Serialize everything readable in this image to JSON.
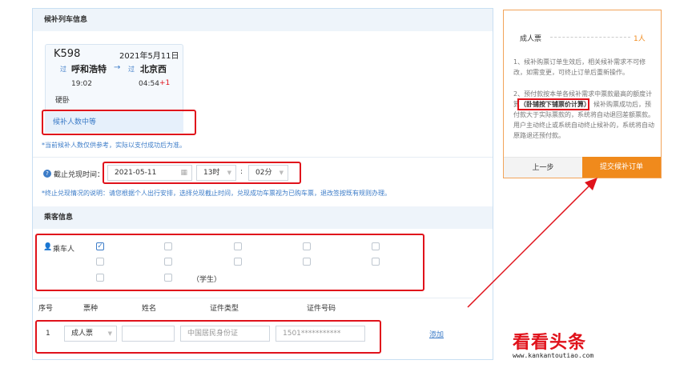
{
  "train_section": {
    "title": "候补列车信息"
  },
  "train": {
    "number": "K598",
    "date": "2021年5月11日",
    "from_tag": "过",
    "from_station": "呼和浩特",
    "to_tag": "过",
    "to_station": "北京西",
    "depart_time": "19:02",
    "arrive_time": "04:54",
    "arrive_plus": "+1",
    "seat": "硬卧",
    "waiting_status": "候补人数中等"
  },
  "note_waiting": "*当前候补人数仅供参考，实际以支付成功后为准。",
  "deadline": {
    "label": "截止兑现时间：",
    "date_value": "2021-05-11",
    "hour_value": "13时",
    "colon": ":",
    "minute_value": "02分"
  },
  "note_deadline": "*终止兑现情况的说明：请您根据个人出行安排，选择兑现截止时间，兑现成功车票视为已购车票，退改签按既有规则办理。",
  "passenger_section": {
    "title": "乘客信息"
  },
  "passengers": {
    "label": "乘车人",
    "student_tag": "（学生）"
  },
  "table": {
    "headers": [
      "序号",
      "票种",
      "姓名",
      "证件类型",
      "证件号码"
    ],
    "row": {
      "index": "1",
      "ticket_type": "成人票",
      "name": "",
      "id_type_placeholder": "中国居民身份证",
      "id_number": "1501***********"
    },
    "add_link": "添加"
  },
  "side": {
    "ticket_label": "成人票",
    "ticket_count": "1人",
    "tip1": "1、候补购票订单生效后，相关候补需求不可修改，如需变更，可终止订单后重新操作。",
    "tip2_a": "2、预付款按本单各候补需求中票款最高的额度计算",
    "tip2_highlight": "（卧铺按下铺票价计算）",
    "tip2_b": "；候补购票成功后，预付款大于实际票款的，系统将自动退回差额票款。用户主动终止或系统自动终止候补的，系统将自动原路退还预付款。",
    "prev_label": "上一步",
    "submit_label": "提交候补订单"
  },
  "watermark": {
    "cn": "看看头条",
    "url": "www.kankantoutiao.com"
  },
  "colors": {
    "accent_blue": "#3c7cc8",
    "accent_orange": "#f08a1c",
    "highlight_red": "#e0121b",
    "arrive_plus": "#e0121b"
  }
}
